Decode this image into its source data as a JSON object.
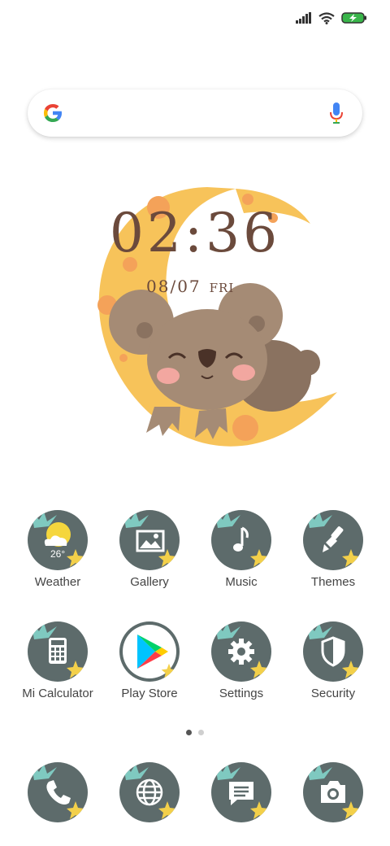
{
  "status_bar": {
    "signal_icon": "signal-icon",
    "wifi_icon": "wifi-icon",
    "battery_icon": "battery-charging-icon",
    "battery_color": "#39b54a"
  },
  "search": {
    "logo_icon": "google-g-icon",
    "mic_icon": "microphone-icon"
  },
  "clock": {
    "time": "02:36",
    "date": "08/07",
    "day": "FRI",
    "color": "#6b4a3c"
  },
  "apps": [
    {
      "label": "Weather",
      "icon": "weather-sun-icon",
      "temp": "26°"
    },
    {
      "label": "Gallery",
      "icon": "image-icon"
    },
    {
      "label": "Music",
      "icon": "music-note-icon"
    },
    {
      "label": "Themes",
      "icon": "paintbrush-icon"
    },
    {
      "label": "Mi Calculator",
      "icon": "calculator-icon"
    },
    {
      "label": "Play Store",
      "icon": "play-store-icon"
    },
    {
      "label": "Settings",
      "icon": "gear-icon"
    },
    {
      "label": "Security",
      "icon": "shield-icon"
    }
  ],
  "dock": [
    {
      "icon": "phone-icon"
    },
    {
      "icon": "globe-icon"
    },
    {
      "icon": "message-icon"
    },
    {
      "icon": "camera-icon"
    }
  ],
  "pages": {
    "count": 2,
    "active": 1
  },
  "theme": {
    "icon_bg": "#5d6b6b",
    "leaf": "#7fc9c0",
    "star": "#f3d04a",
    "moon": "#f7c35a"
  }
}
